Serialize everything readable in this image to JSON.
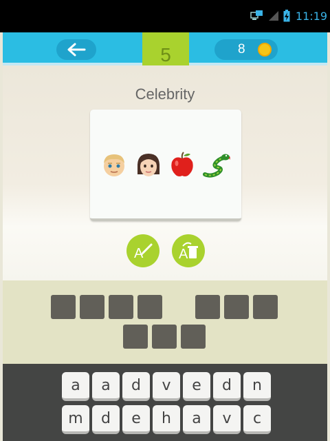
{
  "status_bar": {
    "time": "11:19"
  },
  "header": {
    "back_label": "←",
    "coins": "8",
    "level": "5"
  },
  "puzzle": {
    "category": "Celebrity",
    "emojis": [
      "blond-man-face",
      "woman-face",
      "red-apple",
      "green-snake"
    ]
  },
  "hints": [
    "reveal-letter",
    "remove-letters"
  ],
  "answer": {
    "word_lengths": [
      4,
      3,
      3
    ]
  },
  "keyboard": {
    "row1": [
      "a",
      "a",
      "d",
      "v",
      "e",
      "d",
      "n"
    ],
    "row2": [
      "m",
      "d",
      "e",
      "h",
      "a",
      "v",
      "c"
    ]
  },
  "colors": {
    "header": "#2bbde3",
    "accent_green": "#a9d22e",
    "slot": "#615f58",
    "keyboard_bg": "#444544"
  }
}
